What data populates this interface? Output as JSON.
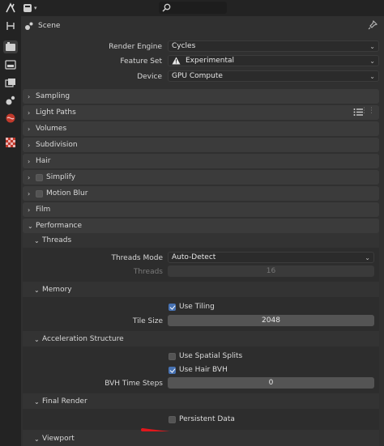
{
  "header": {
    "editor_icon": "properties-editor-icon",
    "search_icon": "search-icon"
  },
  "context": {
    "scene_label": "Scene",
    "pin_icon": "pin-icon"
  },
  "render": {
    "engine_label": "Render Engine",
    "engine_value": "Cycles",
    "feature_label": "Feature Set",
    "feature_value": "Experimental",
    "device_label": "Device",
    "device_value": "GPU Compute"
  },
  "sections": {
    "sampling": "Sampling",
    "light_paths": "Light Paths",
    "volumes": "Volumes",
    "subdivision": "Subdivision",
    "hair": "Hair",
    "simplify": "Simplify",
    "motion_blur": "Motion Blur",
    "film": "Film",
    "performance": "Performance"
  },
  "performance": {
    "threads": {
      "title": "Threads",
      "mode_label": "Threads Mode",
      "mode_value": "Auto-Detect",
      "threads_label": "Threads",
      "threads_value": "16"
    },
    "memory": {
      "title": "Memory",
      "use_tiling_label": "Use Tiling",
      "use_tiling": true,
      "tile_size_label": "Tile Size",
      "tile_size_value": "2048"
    },
    "acceleration": {
      "title": "Acceleration Structure",
      "spatial_splits_label": "Use Spatial Splits",
      "spatial_splits": false,
      "hair_bvh_label": "Use Hair BVH",
      "hair_bvh": true,
      "bvh_steps_label": "BVH Time Steps",
      "bvh_steps_value": "0"
    },
    "final_render": {
      "title": "Final Render",
      "persistent_label": "Persistent Data",
      "persistent": false
    },
    "viewport": {
      "title": "Viewport"
    }
  },
  "colors": {
    "accent": "#4772b3",
    "annotation": "#e0171c"
  }
}
